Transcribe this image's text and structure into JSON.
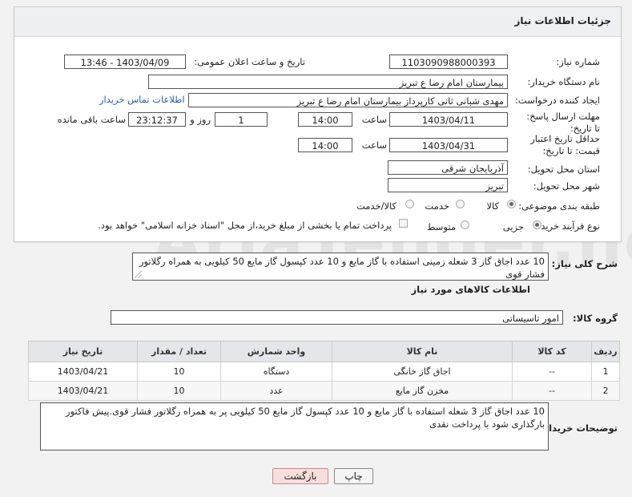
{
  "panel": {
    "title": "جزئیات اطلاعات نیاز"
  },
  "fields": {
    "need_number_label": "شماره نیاز:",
    "need_number": "1103090988000393",
    "announce_label": "تاریخ و ساعت اعلان عمومی:",
    "announce_value": "1403/04/09 - 13:46",
    "buyer_org_label": "نام دستگاه خریدار:",
    "buyer_org": "بیمارستان امام رضا  ع  تبریز",
    "creator_label": "ایجاد کننده درخواست:",
    "creator": "مهدی شبانی ثانی کارپرداز بیمارستان امام رضا  ع  تبریز",
    "contact_link": "اطلاعات تماس خریدار",
    "deadline_label": "مهلت ارسال پاسخ: تا تاریخ:",
    "deadline_date": "1403/04/11",
    "time_label": "ساعت",
    "deadline_time": "14:00",
    "days_value": "1",
    "days_label": "روز و",
    "remaining_time": "23:12:37",
    "remaining_label": "ساعت باقی مانده",
    "validity_label": "حداقل تاریخ اعتبار قیمت: تا تاریخ:",
    "validity_date": "1403/04/31",
    "validity_time": "14:00",
    "province_label": "استان محل تحویل:",
    "province": "آذربایجان شرقی",
    "city_label": "شهر محل تحویل:",
    "city": "تبریز",
    "category_label": "طبقه بندی موضوعی:",
    "category_options": [
      "کالا",
      "خدمت",
      "کالا/خدمت"
    ],
    "process_label": "نوع فرآیند خرید :",
    "process_options": [
      "جزیی",
      "متوسط"
    ],
    "payment_note": "پرداخت تمام یا بخشی از مبلغ خرید،از محل \"اسناد خزانه اسلامی\" خواهد بود."
  },
  "summary": {
    "label": "شرح کلی نیاز:",
    "text": "10 عدد اجاق گاز 3 شعله زمینی استفاده با گاز مایع و 10 عدد کپسول گاز مایع 50 کیلویی به همراه رگلاتور فشار قوی"
  },
  "goods": {
    "section_title": "اطلاعات کالاهای مورد نیاز",
    "group_label": "گروه کالا:",
    "group_value": "امور تاسیساتی",
    "columns": [
      "ردیف",
      "کد کالا",
      "نام کالا",
      "واحد شمارش",
      "تعداد / مقدار",
      "تاریخ نیاز"
    ],
    "rows": [
      [
        "1",
        "--",
        "اجاق گاز خانگی",
        "دستگاه",
        "10",
        "1403/04/21"
      ],
      [
        "2",
        "--",
        "مخزن گاز مایع",
        "عدد",
        "10",
        "1403/04/21"
      ]
    ]
  },
  "buyer_notes": {
    "label": "توضیحات خریدار:",
    "text": "10 عدد اجاق گاز 3 شعله استفاده با گاز مایع و 10 عدد کپسول گاز مایع 50 کیلویی پر به همراه رگلاتور فشار قوی.پیش فاکتور بارگذاری شود با پرداخت نقدی"
  },
  "buttons": {
    "print": "چاپ",
    "back": "بازگشت"
  },
  "watermark": "AriaTender.neT",
  "colors": {
    "link": "#2a5ea8",
    "back_button_bg": "#f9dede",
    "header_bg": "#eef0f3"
  }
}
